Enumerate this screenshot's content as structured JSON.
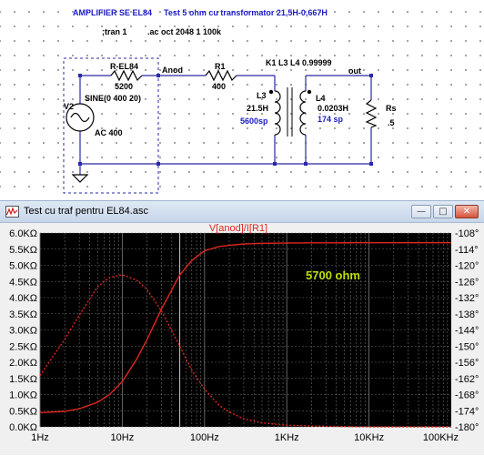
{
  "schematic": {
    "title": "AMPLIFIER SE EL84",
    "test_note": "Test 5 ohm cu transformator 21,5H-0,667H",
    "tran_directive": ";tran 1",
    "ac_directive": ".ac oct 2048 1 100k",
    "coupling_directive": "K1 L3 L4 0.99999",
    "components": {
      "r_el84": {
        "name": "R-EL84",
        "value": "5200"
      },
      "r1": {
        "name": "R1",
        "value": "400"
      },
      "l3": {
        "name": "L3",
        "value": "21.5H",
        "spec": "5600sp"
      },
      "l4": {
        "name": "L4",
        "value": "0.0203H",
        "spec": "174 sp"
      },
      "rs": {
        "name": "Rs",
        "value": ".5"
      },
      "v2": {
        "name": "V2",
        "sine": "SINE(0 400 20)",
        "ac": "AC 400"
      }
    },
    "nets": {
      "anod": "Anod",
      "out": "out"
    },
    "colors": {
      "directive_blue": "#1a1ac8",
      "wire": "#2929a8"
    }
  },
  "window": {
    "title": "Test  cu traf pentru EL84.asc",
    "buttons": {
      "minimize": "—",
      "maximize": "□",
      "close": "✕"
    },
    "icon": "waveform-icon"
  },
  "plot": {
    "trace_label": "V[anod]/I[R1]",
    "annotation": "5700 ohm",
    "colors": {
      "background": "#000000",
      "trace": "#e0261e",
      "grid": "#6e6e6e",
      "cursor": "#c9c9a0",
      "annotation": "#bfe000"
    }
  },
  "chart_data": {
    "type": "line",
    "title": "V[anod]/I[R1]",
    "xscale": "log",
    "xlim": [
      1,
      100000
    ],
    "x_ticks": [
      "1Hz",
      "10Hz",
      "100Hz",
      "1KHz",
      "10KHz",
      "100KHz"
    ],
    "y_left_ticks": [
      "0.0KΩ",
      "0.5KΩ",
      "1.0KΩ",
      "1.5KΩ",
      "2.0KΩ",
      "2.5KΩ",
      "3.0KΩ",
      "3.5KΩ",
      "4.0KΩ",
      "4.5KΩ",
      "5.0KΩ",
      "5.5KΩ",
      "6.0KΩ"
    ],
    "y_right_ticks": [
      "-108°",
      "-114°",
      "-120°",
      "-126°",
      "-132°",
      "-138°",
      "-144°",
      "-150°",
      "-156°",
      "-162°",
      "-168°",
      "-174°",
      "-180°"
    ],
    "ylim_left": [
      0,
      6000
    ],
    "ylim_right": [
      -180,
      -108
    ],
    "cursor_x": 50,
    "series": [
      {
        "name": "magnitude",
        "axis": "left",
        "style": "solid",
        "x": [
          1,
          2,
          3,
          5,
          7,
          10,
          15,
          20,
          30,
          50,
          70,
          100,
          150,
          200,
          300,
          500,
          1000,
          2000,
          5000,
          10000,
          100000
        ],
        "y": [
          440,
          480,
          560,
          760,
          1000,
          1400,
          2100,
          2700,
          3650,
          4700,
          5150,
          5450,
          5580,
          5620,
          5660,
          5680,
          5690,
          5695,
          5697,
          5699,
          5700
        ]
      },
      {
        "name": "phase",
        "axis": "right",
        "style": "dashed",
        "x": [
          1,
          1.5,
          2,
          3,
          5,
          7,
          10,
          15,
          20,
          30,
          50,
          70,
          100,
          150,
          200,
          300,
          500,
          1000,
          2000,
          5000,
          10000,
          100000
        ],
        "y": [
          -161,
          -153,
          -147.5,
          -138.5,
          -128,
          -124.5,
          -123.5,
          -125.5,
          -129,
          -137,
          -150,
          -159,
          -166,
          -172,
          -174.5,
          -177,
          -178.5,
          -179.4,
          -179.7,
          -179.9,
          -180,
          -180
        ]
      }
    ]
  }
}
